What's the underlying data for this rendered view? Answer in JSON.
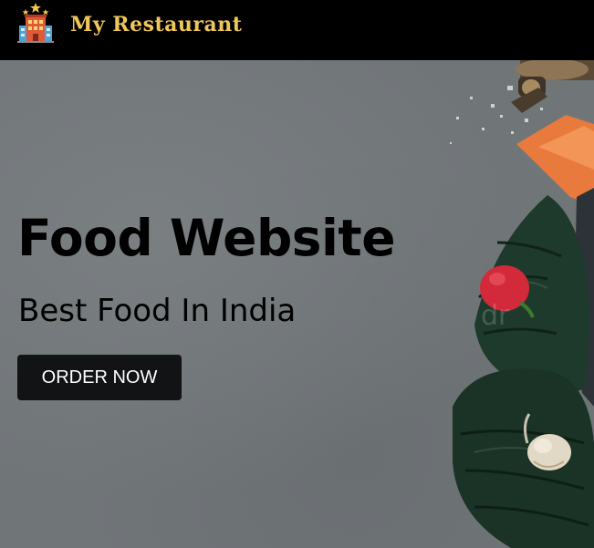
{
  "navbar": {
    "brand_name": "My Restaurant",
    "logo_icon": "restaurant-building-icon"
  },
  "hero": {
    "title": "Food Website",
    "subtitle": "Best Food In India",
    "cta_label": "ORDER NOW",
    "watermark": "dr"
  },
  "colors": {
    "navbar_bg": "#000000",
    "brand_text": "#f0c65a",
    "hero_bg": "#707578",
    "title_text": "#000000",
    "button_bg": "#111315",
    "button_text": "#ffffff"
  }
}
